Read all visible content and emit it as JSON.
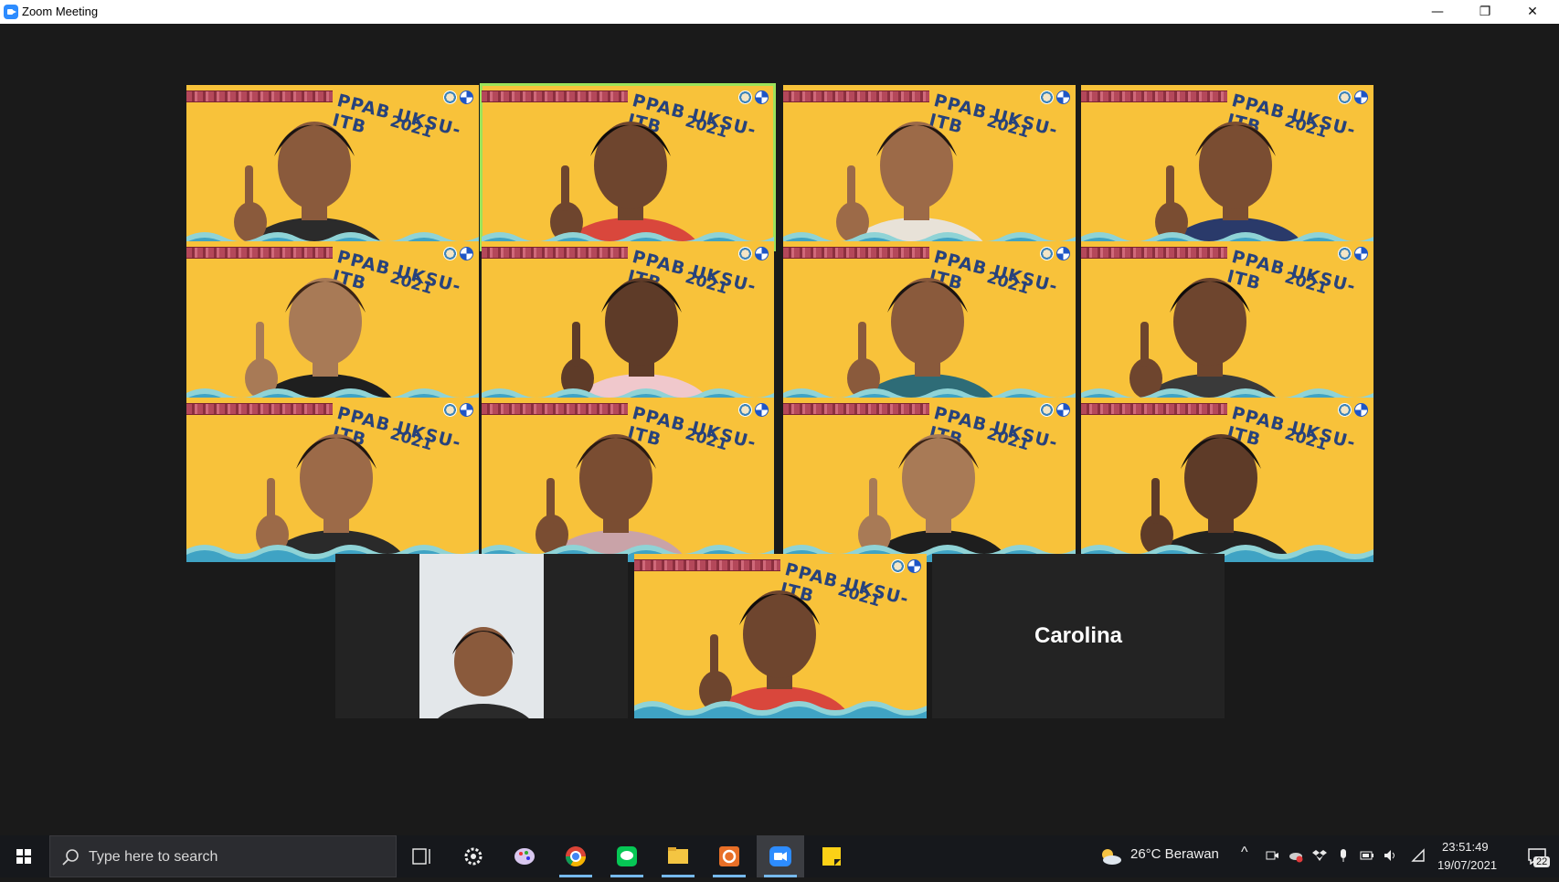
{
  "window": {
    "title": "Zoom Meeting",
    "minimize_glyph": "—",
    "restore_glyph": "❐",
    "close_glyph": "✕"
  },
  "background_text": {
    "event": "PPAB UKSU-ITB",
    "year": "2021"
  },
  "participants": [
    {
      "id": "p1",
      "display": "virtual-background",
      "active_speaker": false
    },
    {
      "id": "p2",
      "display": "virtual-background",
      "active_speaker": true
    },
    {
      "id": "p3",
      "display": "virtual-background",
      "active_speaker": false
    },
    {
      "id": "p4",
      "display": "virtual-background",
      "active_speaker": false
    },
    {
      "id": "p5",
      "display": "virtual-background",
      "active_speaker": false
    },
    {
      "id": "p6",
      "display": "virtual-background",
      "active_speaker": false
    },
    {
      "id": "p7",
      "display": "virtual-background",
      "active_speaker": false
    },
    {
      "id": "p8",
      "display": "virtual-background",
      "active_speaker": false
    },
    {
      "id": "p9",
      "display": "virtual-background",
      "active_speaker": false
    },
    {
      "id": "p10",
      "display": "virtual-background",
      "active_speaker": false
    },
    {
      "id": "p11",
      "display": "virtual-background",
      "active_speaker": false
    },
    {
      "id": "p12",
      "display": "virtual-background",
      "active_speaker": false
    },
    {
      "id": "p13",
      "display": "plain-camera",
      "active_speaker": false
    },
    {
      "id": "p14",
      "display": "virtual-background",
      "active_speaker": false
    },
    {
      "id": "p15",
      "display": "name-only",
      "name": "Carolina",
      "active_speaker": false
    }
  ],
  "taskbar": {
    "search_placeholder": "Type here to search",
    "weather": "26°C  Berawan",
    "time": "23:51:49",
    "date": "19/07/2021",
    "notification_count": "22",
    "apps": [
      "task-view-icon",
      "settings-icon",
      "paint-icon",
      "chrome-icon",
      "line-icon",
      "file-explorer-icon",
      "powerpoint-icon",
      "zoom-icon",
      "sticky-notes-icon"
    ]
  },
  "colors": {
    "meeting_bg": "#1a1a1a",
    "virtual_bg": "#f8c23a",
    "active_border": "#9be35a",
    "zoom_blue": "#2d8cff",
    "taskbar": "#16181c"
  }
}
